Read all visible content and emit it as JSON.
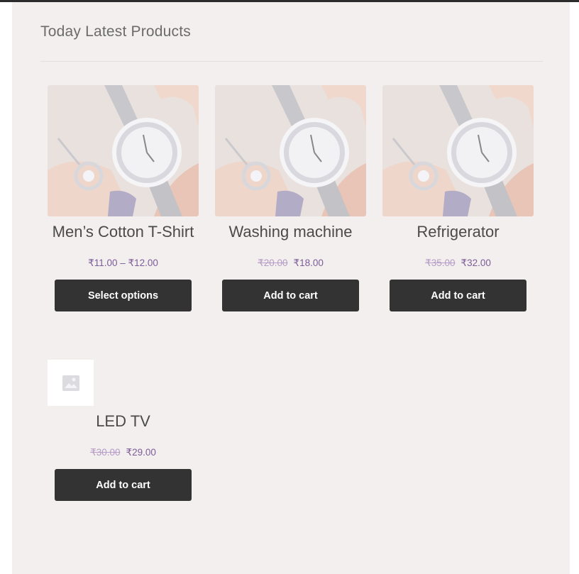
{
  "section": {
    "title": "Today Latest Products"
  },
  "products": [
    {
      "title": "Men’s Cotton T-Shirt",
      "price_range": "₹11.00 – ₹12.00",
      "button_label": "Select options",
      "image": "watch-photo"
    },
    {
      "title": "Washing machine",
      "price_old": "₹20.00",
      "price_new": "₹18.00",
      "button_label": "Add to cart",
      "image": "watch-photo"
    },
    {
      "title": "Refrigerator",
      "price_old": "₹35.00",
      "price_new": "₹32.00",
      "button_label": "Add to cart",
      "image": "watch-photo"
    },
    {
      "title": "LED TV",
      "price_old": "₹30.00",
      "price_new": "₹29.00",
      "button_label": "Add to cart",
      "image": "placeholder-image-icon"
    }
  ],
  "colors": {
    "background": "#f3efee",
    "button": "#333333",
    "price": "#7c5c98",
    "price_struck": "#b69cc7"
  }
}
